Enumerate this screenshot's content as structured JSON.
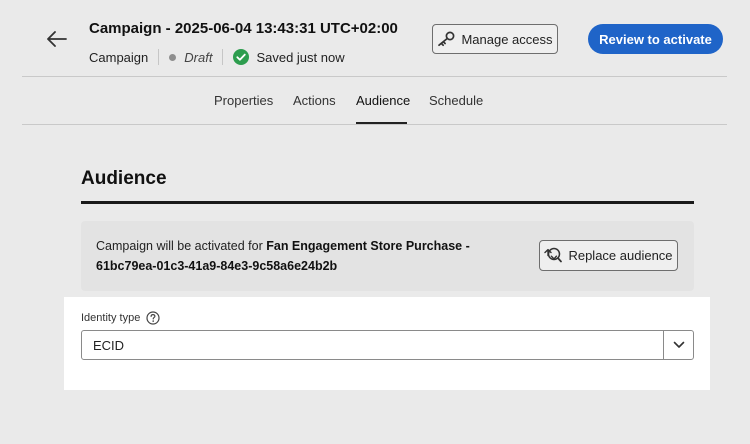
{
  "header": {
    "title": "Campaign - 2025-06-04 13:43:31 UTC+02:00",
    "type": "Campaign",
    "status": "Draft",
    "save_status": "Saved just now",
    "manage_access_label": "Manage access",
    "review_label": "Review to activate"
  },
  "tabs": [
    {
      "label": "Properties"
    },
    {
      "label": "Actions"
    },
    {
      "label": "Audience",
      "active": true
    },
    {
      "label": "Schedule"
    }
  ],
  "audience": {
    "heading": "Audience",
    "info_prefix": "Campaign will be activated for ",
    "audience_name": "Fan Engagement Store Purchase - 61bc79ea-01c3-41a9-84e3-9c58a6e24b2b",
    "replace_label": "Replace audience",
    "identity_label": "Identity type",
    "identity_value": "ECID"
  },
  "colors": {
    "accent": "#1f64c8",
    "success": "#2d9d4e",
    "background": "#eaeaea"
  },
  "icons": {
    "back": "arrow-left-icon",
    "status": "status-dot-icon",
    "saved": "checkmark-circle-icon",
    "manage": "key-icon",
    "replace": "replace-audience-icon",
    "help": "help-circle-icon",
    "dropdown": "chevron-down-icon"
  }
}
